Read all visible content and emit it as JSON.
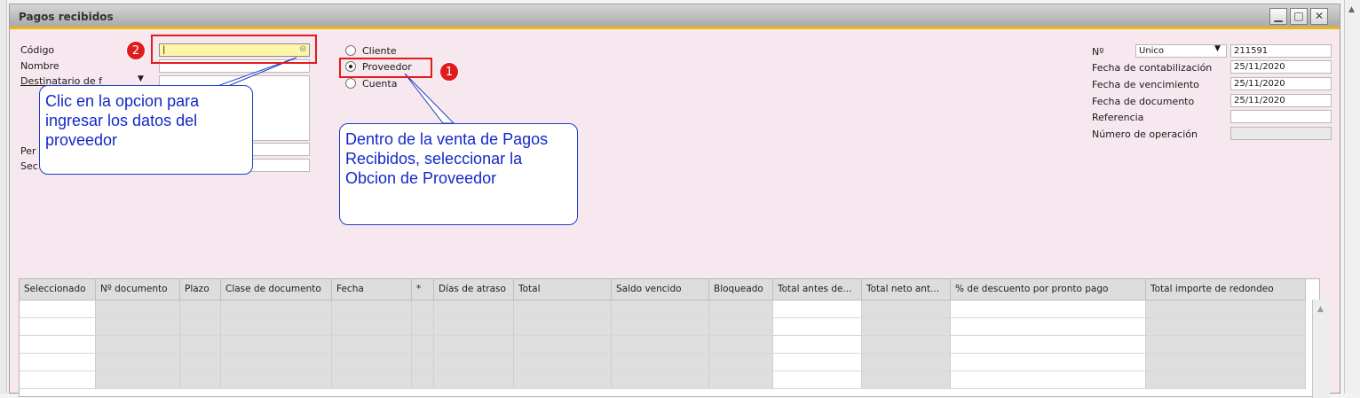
{
  "window": {
    "title": "Pagos recibidos"
  },
  "header_left": {
    "codigo_label": "Código",
    "nombre_label": "Nombre",
    "destinatario_label": "Destinatario de f",
    "persona_label": "Per",
    "sector_label": "Sec",
    "codigo_value": "|",
    "nombre_value": ""
  },
  "radio": {
    "cliente": "Cliente",
    "proveedor": "Proveedor",
    "cuenta": "Cuenta",
    "selected": "Proveedor"
  },
  "header_right": {
    "no_label": "Nº",
    "series_value": "Unico",
    "number_value": "211591",
    "fecha_contab_label": "Fecha de contabilización",
    "fecha_contab_value": "25/11/2020",
    "fecha_venc_label": "Fecha de vencimiento",
    "fecha_venc_value": "25/11/2020",
    "fecha_doc_label": "Fecha de documento",
    "fecha_doc_value": "25/11/2020",
    "referencia_label": "Referencia",
    "referencia_value": "",
    "num_operacion_label": "Número de operación",
    "num_operacion_value": ""
  },
  "annotations": {
    "badge1": "1",
    "badge2": "2",
    "callout_codigo": "Clic en la opcion para ingresar los datos del proveedor",
    "callout_proveedor": "Dentro de la venta de Pagos Recibidos, seleccionar la Obcion de Proveedor",
    "accent_color": "#e21b1b",
    "callout_text_color": "#1329c7"
  },
  "table": {
    "columns": [
      "Seleccionado",
      "Nº documento",
      "Plazo",
      "Clase de documento",
      "Fecha",
      "*",
      "Días de atraso",
      "Total",
      "Saldo vencido",
      "Bloqueado",
      "Total antes de...",
      "Total neto ant...",
      "% de descuento por pronto pago",
      "Total importe de redondeo"
    ],
    "rows": [
      [
        "",
        "",
        "",
        "",
        "",
        "",
        "",
        "",
        "",
        "",
        "",
        "",
        "",
        ""
      ],
      [
        "",
        "",
        "",
        "",
        "",
        "",
        "",
        "",
        "",
        "",
        "",
        "",
        "",
        ""
      ],
      [
        "",
        "",
        "",
        "",
        "",
        "",
        "",
        "",
        "",
        "",
        "",
        "",
        "",
        ""
      ],
      [
        "",
        "",
        "",
        "",
        "",
        "",
        "",
        "",
        "",
        "",
        "",
        "",
        "",
        ""
      ],
      [
        "",
        "",
        "",
        "",
        "",
        "",
        "",
        "",
        "",
        "",
        "",
        "",
        "",
        ""
      ]
    ]
  }
}
